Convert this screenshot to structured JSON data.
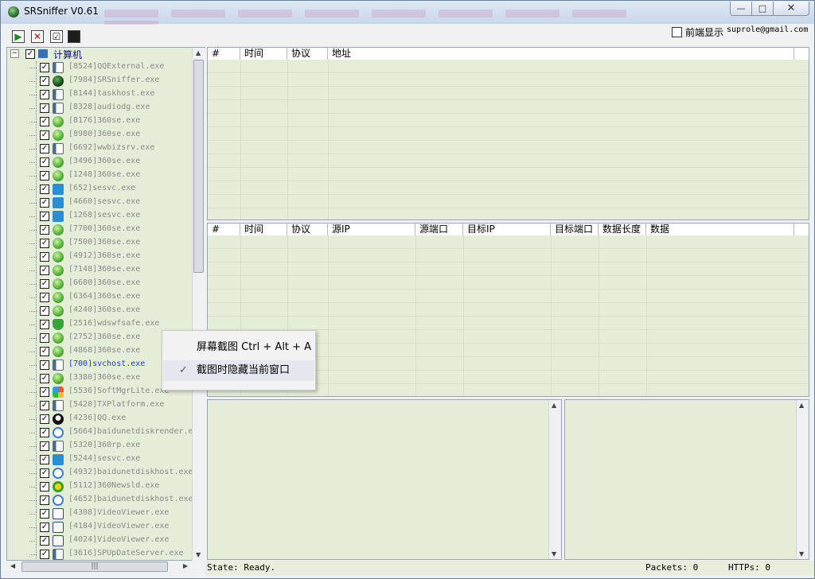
{
  "window": {
    "title": "SRSniffer V0.61",
    "controls": {
      "minimize": "—",
      "maximize": "□",
      "close": "✕"
    }
  },
  "toolbar": {
    "buttons": [
      {
        "name": "start",
        "glyph": "▶",
        "color": "#1a8a1a"
      },
      {
        "name": "stop",
        "glyph": "✕",
        "color": "#d01010"
      },
      {
        "name": "filter",
        "glyph": "☑",
        "color": "#222222"
      },
      {
        "name": "export",
        "glyph": "▦",
        "color": "#1a7a1a"
      }
    ],
    "front_display_label": "前端显示",
    "email": "suprole@gmail.com"
  },
  "process_tree": {
    "root_label": "计算机",
    "processes": [
      {
        "label": "[8524]QQExternal.exe",
        "icon": "generic"
      },
      {
        "label": "[7984]SRSniffer.exe",
        "icon": "dark"
      },
      {
        "label": "[8144]taskhost.exe",
        "icon": "generic"
      },
      {
        "label": "[8328]audiodg.exe",
        "icon": "generic"
      },
      {
        "label": "[8176]360se.exe",
        "icon": "green"
      },
      {
        "label": "[8980]360se.exe",
        "icon": "green"
      },
      {
        "label": "[6692]wwbizsrv.exe",
        "icon": "generic"
      },
      {
        "label": "[3496]360se.exe",
        "icon": "green"
      },
      {
        "label": "[1248]360se.exe",
        "icon": "green"
      },
      {
        "label": "[652]sesvc.exe",
        "icon": "blue"
      },
      {
        "label": "[4660]sesvc.exe",
        "icon": "blue"
      },
      {
        "label": "[1268]sesvc.exe",
        "icon": "blue"
      },
      {
        "label": "[7700]360se.exe",
        "icon": "green"
      },
      {
        "label": "[7500]360se.exe",
        "icon": "green"
      },
      {
        "label": "[4912]360se.exe",
        "icon": "green"
      },
      {
        "label": "[7148]360se.exe",
        "icon": "green"
      },
      {
        "label": "[6680]360se.exe",
        "icon": "green"
      },
      {
        "label": "[6364]360se.exe",
        "icon": "green"
      },
      {
        "label": "[4240]360se.exe",
        "icon": "green"
      },
      {
        "label": "[2516]wdswfsafe.exe",
        "icon": "shield"
      },
      {
        "label": "[2752]360se.exe",
        "icon": "green"
      },
      {
        "label": "[4868]360se.exe",
        "icon": "green"
      },
      {
        "label": "[700]svchost.exe",
        "icon": "generic",
        "selected": true
      },
      {
        "label": "[3380]360se.exe",
        "icon": "green"
      },
      {
        "label": "[5536]SoftMgrLite.exe",
        "icon": "multi"
      },
      {
        "label": "[5420]TXPlatform.exe",
        "icon": "generic"
      },
      {
        "label": "[4236]QQ.exe",
        "icon": "qq"
      },
      {
        "label": "[5664]baidunetdiskrender.e",
        "icon": "cloud"
      },
      {
        "label": "[5320]360rp.exe",
        "icon": "generic"
      },
      {
        "label": "[5244]sesvc.exe",
        "icon": "blue"
      },
      {
        "label": "[4932]baidunetdiskhost.exe",
        "icon": "cloud"
      },
      {
        "label": "[5112]360Newsld.exe",
        "icon": "news"
      },
      {
        "label": "[4652]baidunetdiskhost.exe",
        "icon": "cloud"
      },
      {
        "label": "[4308]VideoViewer.exe",
        "icon": "video"
      },
      {
        "label": "[4184]VideoViewer.exe",
        "icon": "video"
      },
      {
        "label": "[4024]VideoViewer.exe",
        "icon": "video"
      },
      {
        "label": "[3616]SPUpDateServer.exe",
        "icon": "generic"
      }
    ]
  },
  "connection_table": {
    "columns": [
      "#",
      "时间",
      "协议",
      "地址"
    ]
  },
  "packet_table": {
    "columns": [
      "#",
      "时间",
      "协议",
      "源IP",
      "源端口",
      "目标IP",
      "目标端口",
      "数据长度",
      "数据"
    ]
  },
  "context_menu": {
    "items": [
      {
        "label": "屏幕截图 Ctrl + Alt + A",
        "checked": false
      },
      {
        "label": "截图时隐藏当前窗口",
        "checked": true
      }
    ]
  },
  "status": {
    "state": "State: Ready.",
    "packets": "Packets: 0",
    "https": "HTTPs: 0"
  }
}
